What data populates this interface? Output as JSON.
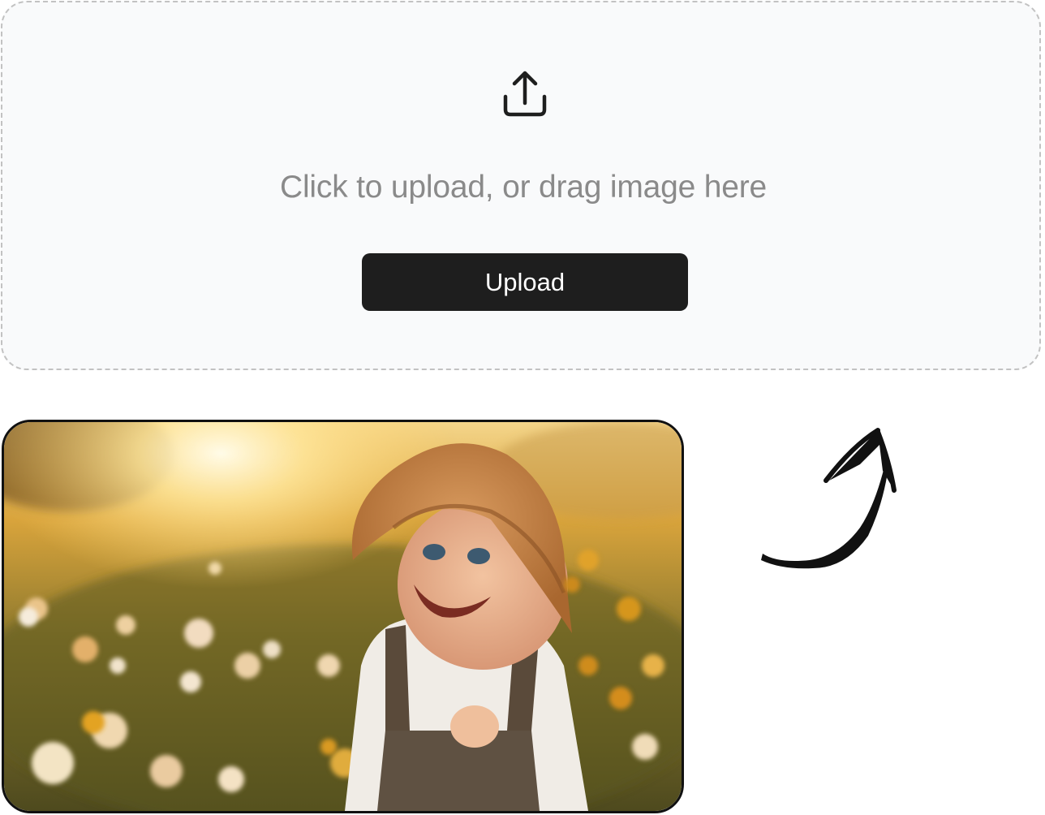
{
  "dropzone": {
    "icon": "upload-icon",
    "prompt": "Click to upload, or drag image here",
    "button_label": "Upload"
  },
  "preview": {
    "image": "photo-of-smiling-baby-in-bucket-hat-in-sunlit-flower-field",
    "arrow_icon": "curved-arrow-icon"
  },
  "colors": {
    "dropzone_bg": "#f9fafb",
    "dropzone_border": "#c2c2c2",
    "button_bg": "#1e1e1e",
    "button_text": "#ffffff",
    "prompt_text": "#8a8a8a"
  }
}
